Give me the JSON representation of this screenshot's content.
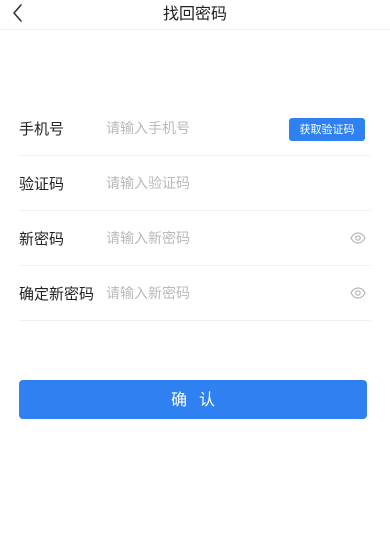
{
  "header": {
    "title": "找回密码"
  },
  "form": {
    "phone": {
      "label": "手机号",
      "placeholder": "请输入手机号",
      "value": ""
    },
    "get_code_label": "获取验证码",
    "code": {
      "label": "验证码",
      "placeholder": "请输入验证码",
      "value": ""
    },
    "new_password": {
      "label": "新密码",
      "placeholder": "请输入新密码",
      "value": ""
    },
    "confirm_password": {
      "label": "确定新密码",
      "placeholder": "请输入新密码",
      "value": ""
    }
  },
  "confirm_button": "确认",
  "icons": {
    "back": "chevron-left-icon",
    "show_password": "eye-icon"
  },
  "colors": {
    "accent": "#2f80f0",
    "placeholder": "#b9b9b9",
    "divider": "#f0f0f0"
  }
}
